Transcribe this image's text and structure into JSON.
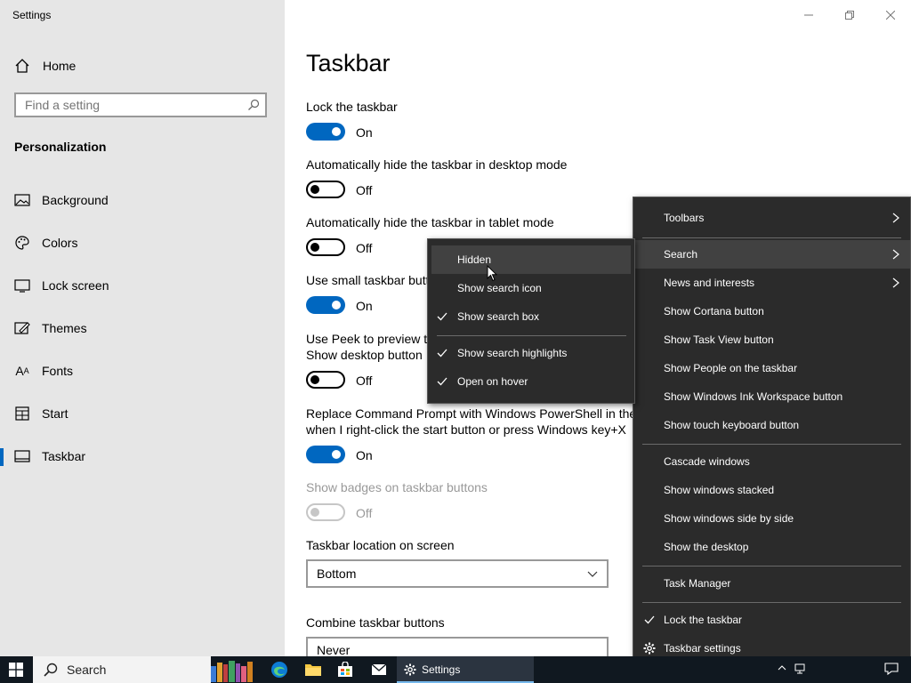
{
  "window": {
    "title": "Settings"
  },
  "sidebar": {
    "home_label": "Home",
    "search_placeholder": "Find a setting",
    "section_title": "Personalization",
    "items": [
      {
        "label": "Background",
        "icon": "picture-icon"
      },
      {
        "label": "Colors",
        "icon": "palette-icon"
      },
      {
        "label": "Lock screen",
        "icon": "monitor-icon"
      },
      {
        "label": "Themes",
        "icon": "brush-icon"
      },
      {
        "label": "Fonts",
        "icon": "font-icon"
      },
      {
        "label": "Start",
        "icon": "start-icon"
      },
      {
        "label": "Taskbar",
        "icon": "taskbar-icon",
        "active": true
      }
    ]
  },
  "main": {
    "title": "Taskbar",
    "settings": [
      {
        "label": "Lock the taskbar",
        "state": "On"
      },
      {
        "label": "Automatically hide the taskbar in desktop mode",
        "state": "Off"
      },
      {
        "label": "Automatically hide the taskbar in tablet mode",
        "state": "Off"
      },
      {
        "label": "Use small taskbar butt",
        "state": "On"
      },
      {
        "label_line1": "Use Peek to preview th",
        "label_line2": "Show desktop button",
        "state": "Off"
      },
      {
        "label_line1": "Replace Command Prompt with Windows PowerShell in the",
        "label_line2": "when I right-click the start button or press Windows key+X",
        "state": "On"
      },
      {
        "label": "Show badges on taskbar buttons",
        "state": "Off",
        "disabled": true
      }
    ],
    "location_label": "Taskbar location on screen",
    "location_value": "Bottom",
    "combine_label": "Combine taskbar buttons",
    "combine_value": "Never"
  },
  "taskbar_menu": {
    "items": [
      {
        "label": "Toolbars",
        "submenu": true
      },
      {
        "label": "Search",
        "submenu": true,
        "highlighted": true
      },
      {
        "label": "News and interests",
        "submenu": true
      },
      {
        "label": "Show Cortana button"
      },
      {
        "label": "Show Task View button"
      },
      {
        "label": "Show People on the taskbar"
      },
      {
        "label": "Show Windows Ink Workspace button"
      },
      {
        "label": "Show touch keyboard button"
      },
      {
        "label": "Cascade windows"
      },
      {
        "label": "Show windows stacked"
      },
      {
        "label": "Show windows side by side"
      },
      {
        "label": "Show the desktop"
      },
      {
        "label": "Task Manager"
      },
      {
        "label": "Lock the taskbar",
        "checked": true
      },
      {
        "label": "Taskbar settings",
        "icon": "gear-icon"
      }
    ]
  },
  "search_submenu": {
    "items": [
      {
        "label": "Hidden",
        "highlighted": true
      },
      {
        "label": "Show search icon"
      },
      {
        "label": "Show search box",
        "checked": true
      },
      {
        "label": "Show search highlights",
        "checked": true
      },
      {
        "label": "Open on hover",
        "checked": true
      }
    ]
  },
  "taskbar": {
    "search_label": "Search",
    "settings_app_label": "Settings"
  },
  "colors": {
    "accent": "#0067c0",
    "menu_bg": "#2b2b2b",
    "taskbar_bg": "#101820"
  }
}
